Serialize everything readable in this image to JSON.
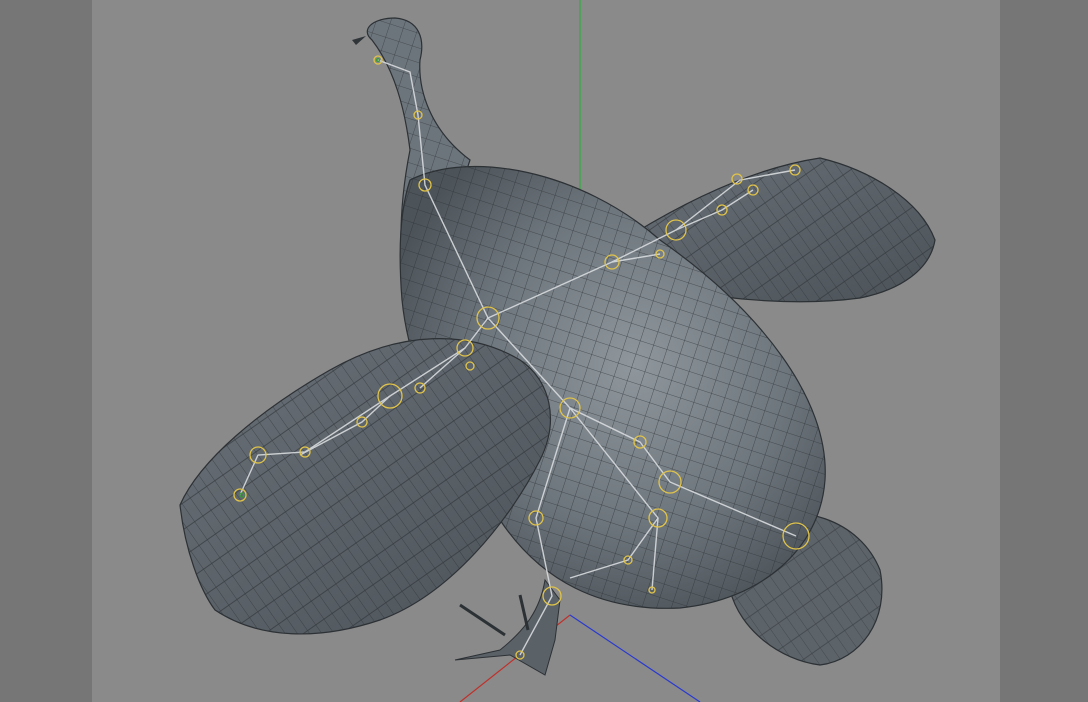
{
  "viewport": {
    "background": "#8a8a8a",
    "side_panel_color": "#767676",
    "model": "bird-3d-mesh",
    "rig": "bone-skeleton",
    "axis_colors": {
      "x": "#c0302a",
      "y": "#2fae3c",
      "z": "#2a3ad0"
    }
  },
  "icons": [
    "bird-mesh-icon",
    "bone-icon",
    "joint-icon",
    "axis-gizmo-icon"
  ]
}
